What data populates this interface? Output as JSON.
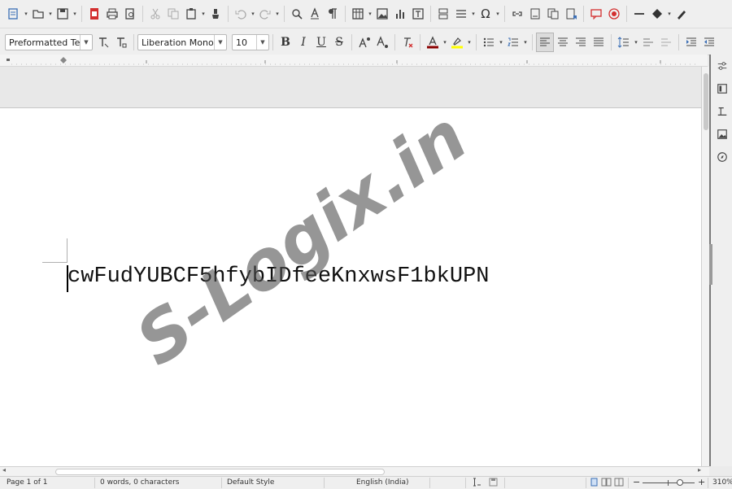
{
  "toolbar2": {
    "paragraph_style": "Preformatted Text",
    "font_name": "Liberation Mono",
    "font_size": "10"
  },
  "document": {
    "text": "cwFudYUBCF5hfybIDfeeKnxwsF1bkUPN"
  },
  "watermark": {
    "text": "S-Logix.in"
  },
  "statusbar": {
    "page": "Page 1 of 1",
    "words": "0 words, 0 characters",
    "page_style": "Default Style",
    "language": "English (India)",
    "zoom": "310%"
  },
  "colors": {
    "font_color": "#8b0000",
    "highlight_color": "#ffff00"
  },
  "icons": {
    "toolbar1": [
      "new-icon",
      "open-icon",
      "save-icon",
      "export-pdf-icon",
      "print-icon",
      "print-preview-icon",
      "cut-icon",
      "copy-icon",
      "paste-icon",
      "clone-formatting-icon",
      "undo-icon",
      "redo-icon",
      "find-replace-icon",
      "spelling-icon",
      "formatting-marks-icon",
      "insert-table-icon",
      "insert-image-icon",
      "insert-chart-icon",
      "insert-textbox-icon",
      "page-break-icon",
      "insert-field-icon",
      "special-character-icon",
      "hyperlink-icon",
      "footnote-icon",
      "endnote-icon",
      "bookmark-icon",
      "comment-icon",
      "track-changes-icon",
      "line-icon",
      "basic-shapes-icon",
      "draw-function-icon"
    ]
  }
}
